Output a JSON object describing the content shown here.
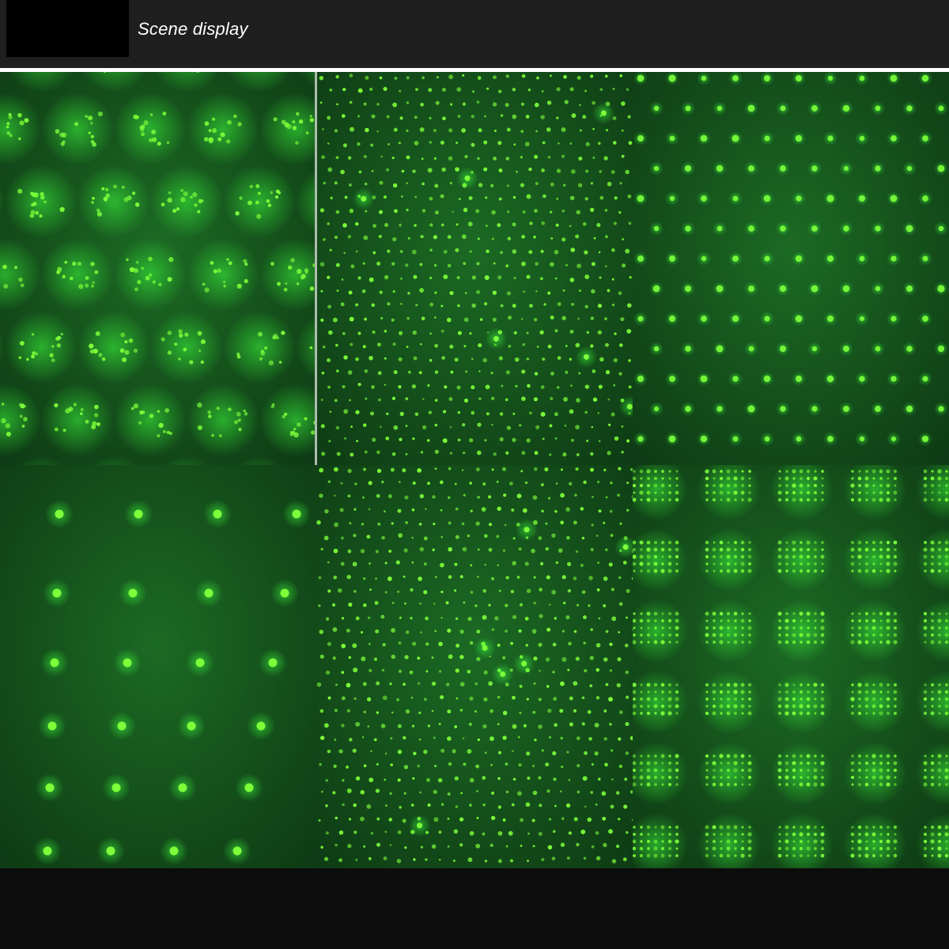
{
  "header": {
    "title": "Scene display"
  },
  "colors": {
    "laser_green": "#7dff3a",
    "panel_background": "#0e3a14",
    "header_background": "#1f1f1f"
  },
  "gallery": {
    "panels": [
      {
        "id": "panel-1",
        "pattern": "clustered-diamond-dots"
      },
      {
        "id": "panel-2",
        "pattern": "dense-star-dots"
      },
      {
        "id": "panel-3",
        "pattern": "medium-grid-dots"
      },
      {
        "id": "panel-4",
        "pattern": "sparse-grid-dots"
      },
      {
        "id": "panel-5",
        "pattern": "dense-star-dots"
      },
      {
        "id": "panel-6",
        "pattern": "clustered-grid-dots"
      }
    ]
  }
}
